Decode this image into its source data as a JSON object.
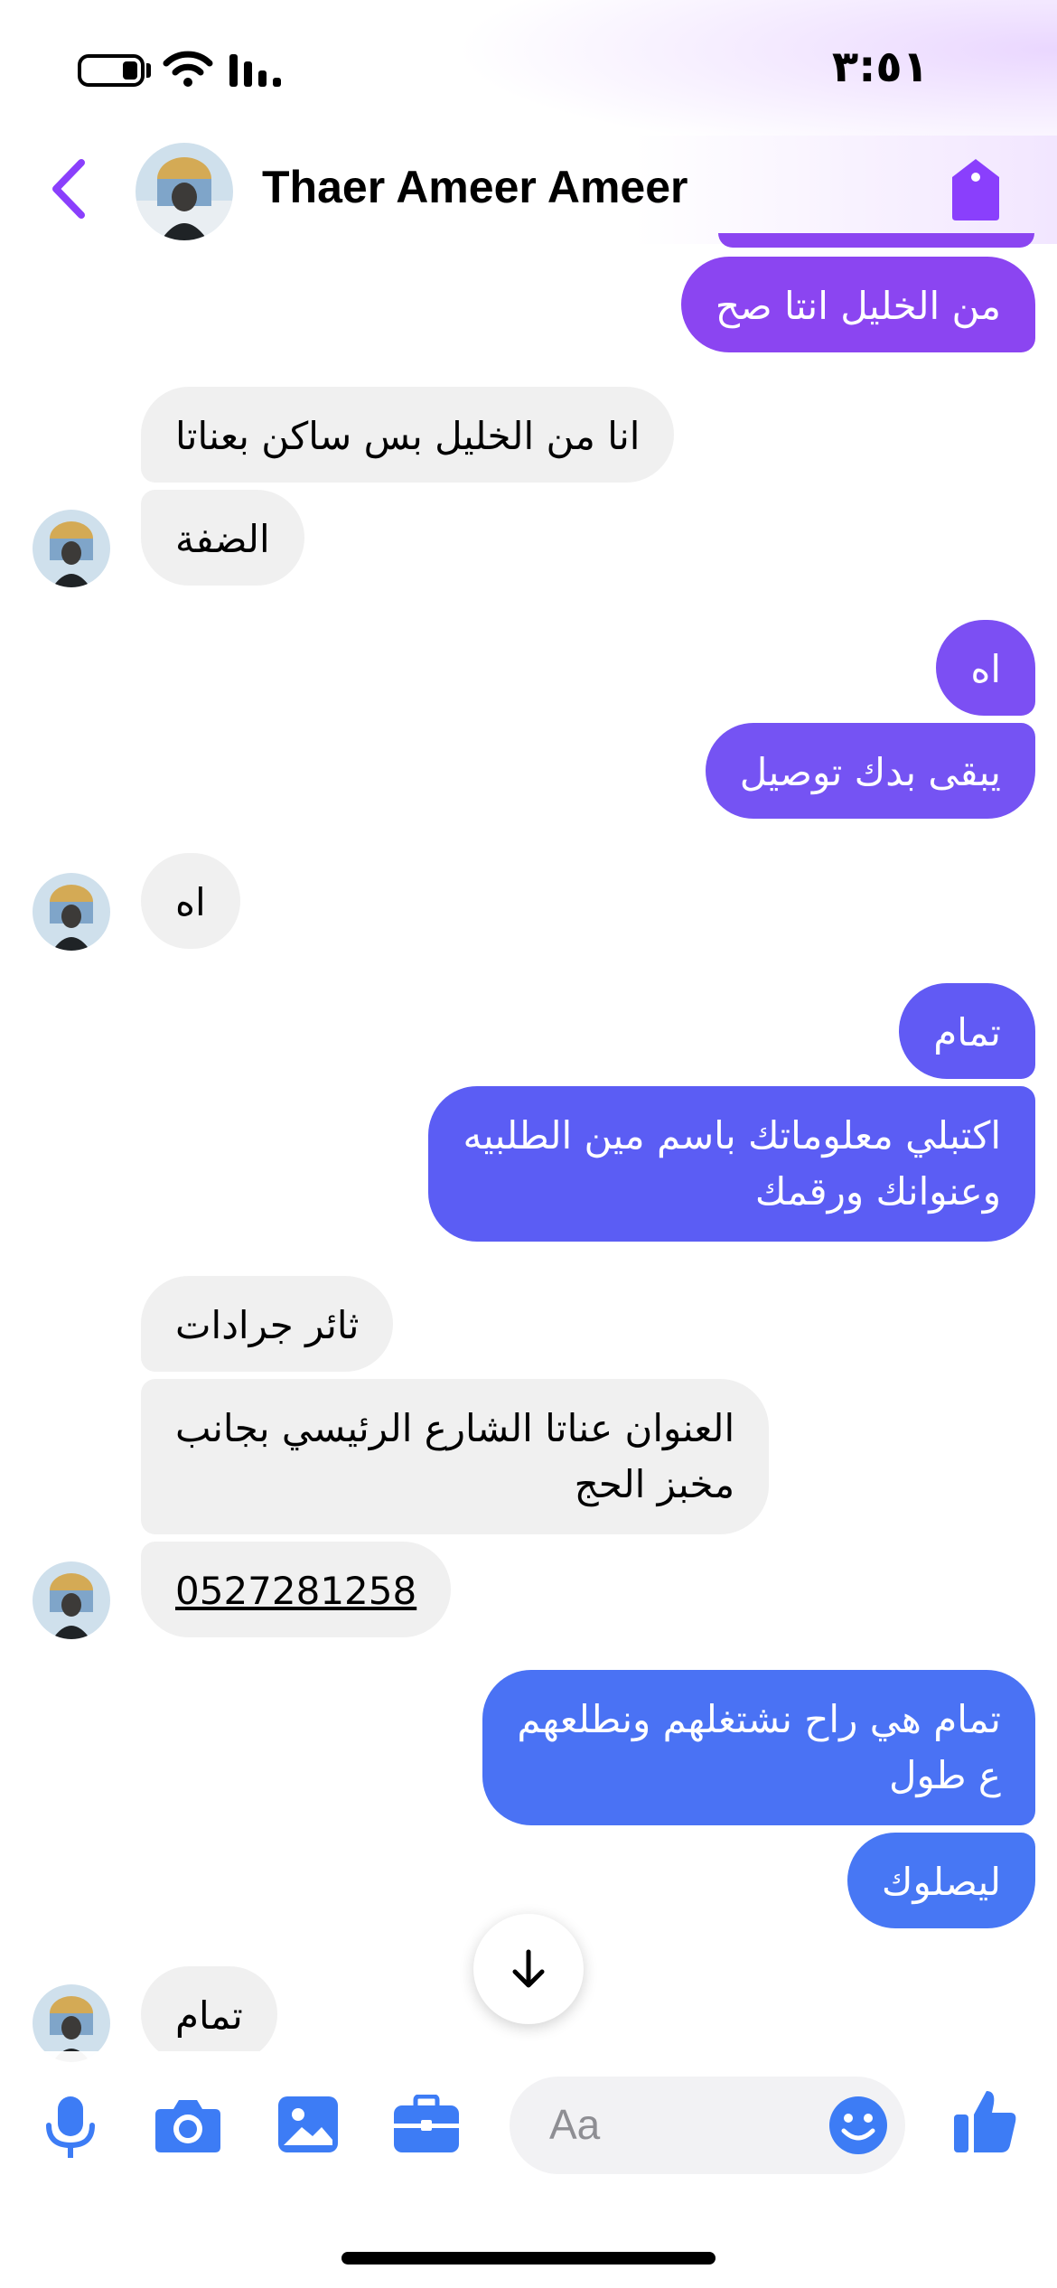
{
  "status_bar": {
    "time": "٣:٥١"
  },
  "header": {
    "contact_name": "Thaer Ameer Ameer"
  },
  "messages": [
    {
      "direction": "out",
      "text": "من الخليل انتا صح"
    },
    {
      "direction": "in",
      "text": "انا من الخليل بس ساكن بعناتا"
    },
    {
      "direction": "in",
      "text": "الضفة"
    },
    {
      "direction": "out",
      "text": "اه"
    },
    {
      "direction": "out",
      "text": "يبقى بدك توصيل"
    },
    {
      "direction": "in",
      "text": "اه"
    },
    {
      "direction": "out",
      "text": "تمام"
    },
    {
      "direction": "out",
      "text": "اكتبلي معلوماتك باسم مين الطلبيه\nوعنوانك ورقمك"
    },
    {
      "direction": "in",
      "text": "ثائر جرادات"
    },
    {
      "direction": "in",
      "text": "العنوان عناتا الشارع الرئيسي بجانب\nمخبز الحج"
    },
    {
      "direction": "in",
      "text": "0527281258"
    },
    {
      "direction": "out",
      "text": "تمام هي راح نشتغلهم ونطلعهم\nع طول"
    },
    {
      "direction": "out",
      "text": "ليصلوك"
    },
    {
      "direction": "in",
      "text": "تمام"
    }
  ],
  "composer": {
    "placeholder": "Aa"
  },
  "colors": {
    "accent": "#8a3ffc",
    "bubble_purple": "#8b45f1",
    "bubble_indigo": "#5b5df4",
    "bubble_blue": "#4a72f4",
    "composer_icon": "#3d7cf5",
    "incoming_bubble": "#f0f0f0"
  },
  "icons": [
    "chevron-left-icon",
    "tag-icon",
    "arrow-down-icon",
    "microphone-icon",
    "camera-icon",
    "image-icon",
    "briefcase-icon",
    "smiley-icon",
    "thumbs-up-icon"
  ]
}
